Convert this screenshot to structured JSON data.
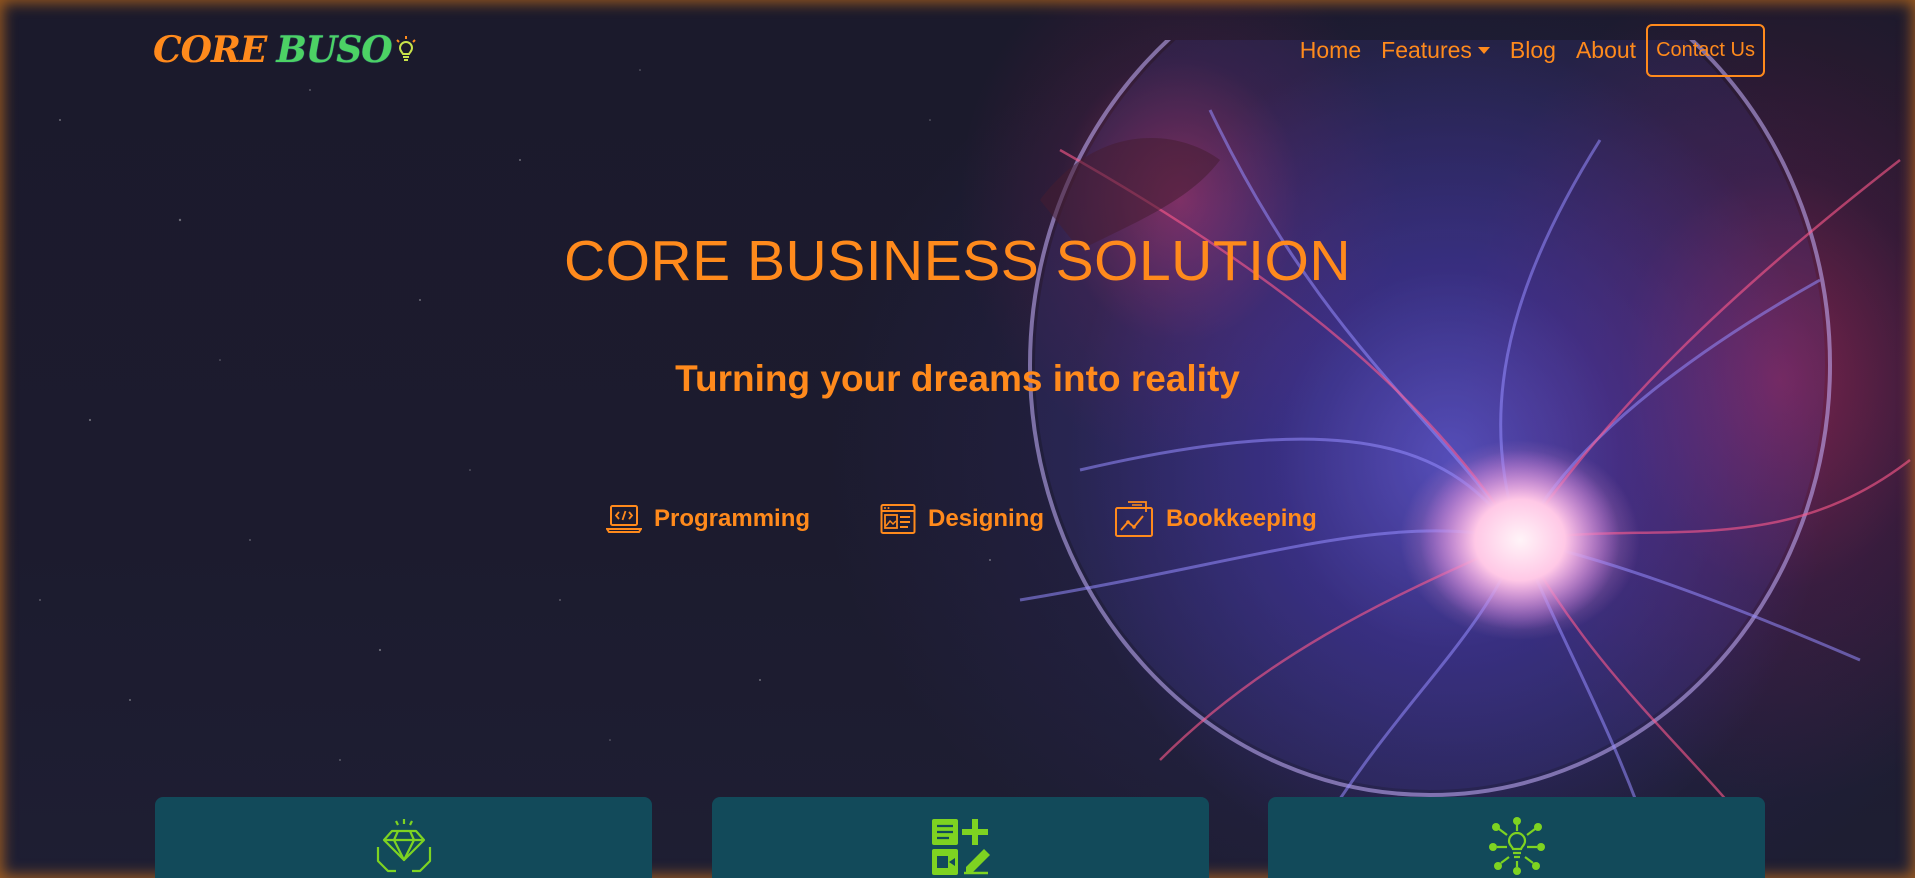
{
  "colors": {
    "accent": "#ff8a1c",
    "logo_green": "#4cd264",
    "card_bg": "#124a5a",
    "card_icon": "#7ed321",
    "background": "#1b1a2c"
  },
  "logo": {
    "part1": "CORE",
    "part2": "BUSO",
    "icon": "lightbulb-icon"
  },
  "nav": {
    "items": [
      {
        "label": "Home"
      },
      {
        "label": "Features",
        "icon": "chevron-down-icon"
      },
      {
        "label": "Blog"
      },
      {
        "label": "About"
      }
    ],
    "contact_label": "Contact Us"
  },
  "hero": {
    "title": "CORE BUSINESS SOLUTION",
    "subtitle": "Turning your dreams into reality"
  },
  "services": [
    {
      "label": "Programming",
      "icon": "laptop-code-icon"
    },
    {
      "label": "Designing",
      "icon": "web-layout-icon"
    },
    {
      "label": "Bookkeeping",
      "icon": "ledger-chart-icon"
    }
  ],
  "cards": [
    {
      "icon": "diamond-hands-icon"
    },
    {
      "icon": "apps-grid-icon"
    },
    {
      "icon": "idea-network-icon"
    }
  ]
}
